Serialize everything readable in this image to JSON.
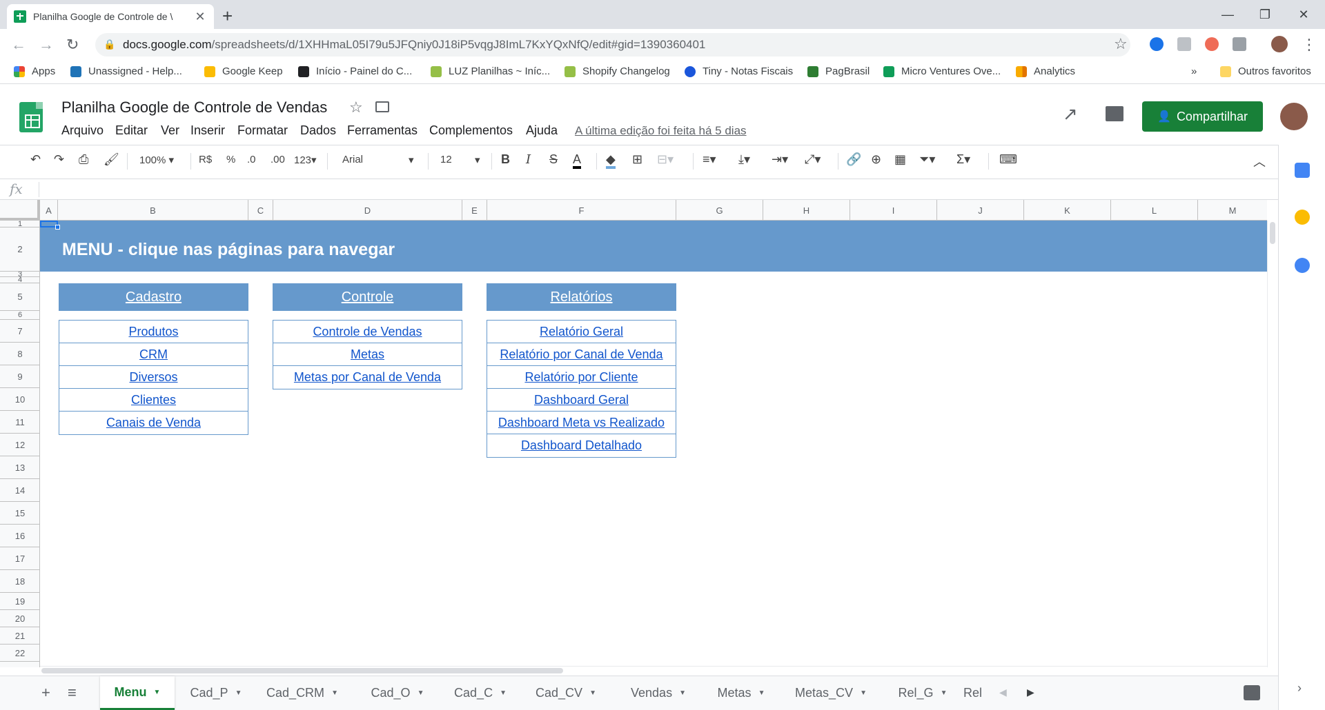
{
  "browser": {
    "tab_title": "Planilha Google de Controle de \\",
    "url_domain": "docs.google.com",
    "url_path": "/spreadsheets/d/1XHHmaL05I79u5JFQniy0J18iP5vqgJ8ImL7KxYQxNfQ/edit#gid=1390360401",
    "bookmarks": [
      "Apps",
      "Unassigned - Help...",
      "Google Keep",
      "Início - Painel do C...",
      "LUZ Planilhas ~ Iníc...",
      "Shopify Changelog",
      "Tiny - Notas Fiscais",
      "PagBrasil",
      "Micro Ventures Ove...",
      "Analytics"
    ],
    "bookmarks_overflow": "»",
    "other_bookmarks": "Outros favoritos"
  },
  "sheets": {
    "doc_title": "Planilha Google de Controle de Vendas",
    "menus": [
      "Arquivo",
      "Editar",
      "Ver",
      "Inserir",
      "Formatar",
      "Dados",
      "Ferramentas",
      "Complementos",
      "Ajuda"
    ],
    "last_edit": "A última edição foi feita há 5 dias",
    "share_label": "Compartilhar",
    "toolbar": {
      "zoom": "100%",
      "currency": "R$",
      "percent": "%",
      "dec_less": ".0",
      "dec_more": ".00",
      "more_formats": "123",
      "font": "Arial",
      "font_size": "12"
    },
    "fx_label": "fx"
  },
  "grid": {
    "columns": [
      "A",
      "B",
      "C",
      "D",
      "E",
      "F",
      "G",
      "H",
      "I",
      "J",
      "K",
      "L",
      "M"
    ],
    "rows": [
      "1",
      "2",
      "3",
      "4",
      "5",
      "6",
      "7",
      "8",
      "9",
      "10",
      "11",
      "12",
      "13",
      "14",
      "15",
      "16",
      "17",
      "18",
      "19",
      "20",
      "21",
      "22"
    ],
    "banner": "MENU - clique nas páginas para navegar",
    "sections": [
      {
        "title": "Cadastro",
        "links": [
          "Produtos",
          "CRM",
          "Diversos",
          "Clientes",
          "Canais de Venda"
        ]
      },
      {
        "title": "Controle",
        "links": [
          "Controle de Vendas",
          "Metas",
          "Metas por Canal de Venda"
        ]
      },
      {
        "title": "Relatórios",
        "links": [
          "Relatório Geral",
          "Relatório por Canal de Venda",
          "Relatório por Cliente",
          "Dashboard Geral",
          "Dashboard Meta vs Realizado",
          "Dashboard Detalhado"
        ]
      }
    ]
  },
  "sheet_tabs": [
    "Menu",
    "Cad_P",
    "Cad_CRM",
    "Cad_O",
    "Cad_C",
    "Cad_CV",
    "Vendas",
    "Metas",
    "Metas_CV",
    "Rel_G",
    "Rel"
  ],
  "active_sheet": "Menu",
  "colors": {
    "accent_green": "#188038",
    "header_blue": "#6699cc",
    "link_blue": "#1155cc"
  }
}
